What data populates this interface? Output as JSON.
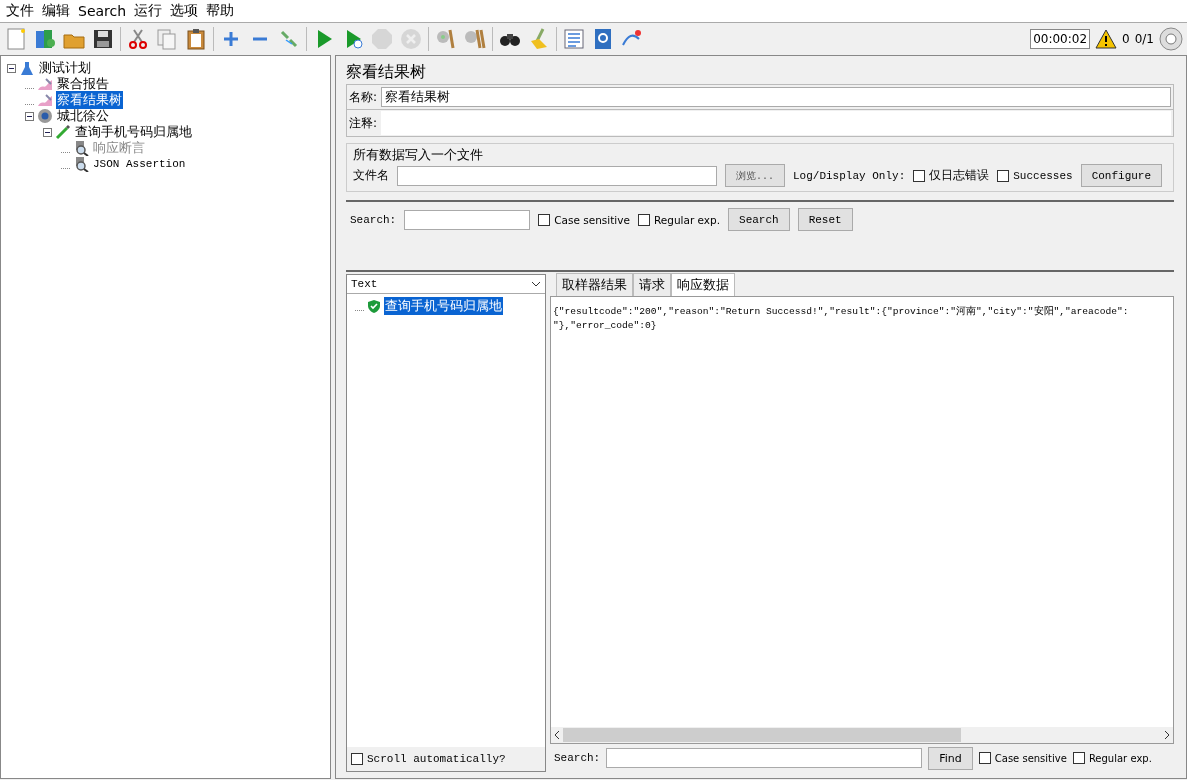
{
  "menu": [
    {
      "label": "文件"
    },
    {
      "label": "编辑"
    },
    {
      "label": "Search"
    },
    {
      "label": "运行"
    },
    {
      "label": "选项"
    },
    {
      "label": "帮助"
    }
  ],
  "toolbar": [
    {
      "kind": "new",
      "disabled": false
    },
    {
      "kind": "templates",
      "disabled": false
    },
    {
      "kind": "open",
      "disabled": false
    },
    {
      "kind": "save",
      "disabled": false
    },
    {
      "kind": "separator"
    },
    {
      "kind": "cut",
      "disabled": false
    },
    {
      "kind": "copy",
      "disabled": false
    },
    {
      "kind": "paste",
      "disabled": false
    },
    {
      "kind": "separator"
    },
    {
      "kind": "expand",
      "disabled": false
    },
    {
      "kind": "collapse",
      "disabled": false
    },
    {
      "kind": "toggle",
      "disabled": false
    },
    {
      "kind": "separator"
    },
    {
      "kind": "start",
      "disabled": false
    },
    {
      "kind": "start-no-timers",
      "disabled": false
    },
    {
      "kind": "stop",
      "disabled": true
    },
    {
      "kind": "shutdown",
      "disabled": true
    },
    {
      "kind": "separator"
    },
    {
      "kind": "clear",
      "disabled": false
    },
    {
      "kind": "clear-all",
      "disabled": false
    },
    {
      "kind": "separator"
    },
    {
      "kind": "search",
      "disabled": false
    },
    {
      "kind": "reset-search",
      "disabled": false
    },
    {
      "kind": "separator"
    },
    {
      "kind": "function-helper",
      "disabled": false
    },
    {
      "kind": "help",
      "disabled": false
    },
    {
      "kind": "remote",
      "disabled": false
    }
  ],
  "status": {
    "timer": "00:00:02",
    "warnings": "0",
    "threads": "0/1"
  },
  "tree": [
    {
      "label": "测试计划",
      "kind": "testplan",
      "selected": false,
      "disabled": false,
      "expanded": true,
      "children": [
        {
          "label": "聚合报告",
          "kind": "listener",
          "selected": false,
          "disabled": false
        },
        {
          "label": "察看结果树",
          "kind": "listener",
          "selected": true,
          "disabled": false
        },
        {
          "label": "城北徐公",
          "kind": "threadgroup",
          "selected": false,
          "disabled": false,
          "expanded": true,
          "children": [
            {
              "label": "查询手机号码归属地",
              "kind": "sampler",
              "selected": false,
              "disabled": false,
              "expanded": true,
              "children": [
                {
                  "label": "响应断言",
                  "kind": "assertion",
                  "selected": false,
                  "disabled": true
                },
                {
                  "label": "JSON Assertion",
                  "kind": "assertion",
                  "selected": false,
                  "disabled": false
                }
              ]
            }
          ]
        }
      ]
    }
  ],
  "panel": {
    "title": "察看结果树",
    "name_label": "名称:",
    "name_value": "察看结果树",
    "comment_label": "注释:",
    "file_group": {
      "title": "所有数据写入一个文件",
      "file_label": "文件名",
      "browse": "浏览...",
      "log_label": "Log/Display Only:",
      "checkboxes": [
        {
          "label": "仅日志错误",
          "checked": false
        },
        {
          "label": "Successes",
          "checked": false
        }
      ],
      "configure": "Configure"
    },
    "search": {
      "label": "Search:",
      "checkboxes": [
        {
          "label": "Case sensitive",
          "checked": false
        },
        {
          "label": "Regular exp.",
          "checked": false
        }
      ],
      "search_button": "Search",
      "reset_button": "Reset"
    }
  },
  "results": {
    "renderer": "Text",
    "items": [
      {
        "label": "查询手机号码归属地",
        "selected": true,
        "success": true
      }
    ],
    "scroll_auto": {
      "label": "Scroll automatically?",
      "checked": false
    },
    "tabs": [
      {
        "label": "取样器结果",
        "selected": false
      },
      {
        "label": "请求",
        "selected": false
      },
      {
        "label": "响应数据",
        "selected": true
      }
    ],
    "response_lines": [
      "{\"resultcode\":\"200\",\"reason\":\"Return Successd!\",\"result\":{\"province\":\"河南\",\"city\":\"安阳\",\"areacode\":",
      "\"},\"error_code\":0}"
    ],
    "find": {
      "label": "Search:",
      "button": "Find",
      "checkboxes": [
        {
          "label": "Case sensitive",
          "checked": false
        },
        {
          "label": "Regular exp.",
          "checked": false
        }
      ]
    }
  }
}
